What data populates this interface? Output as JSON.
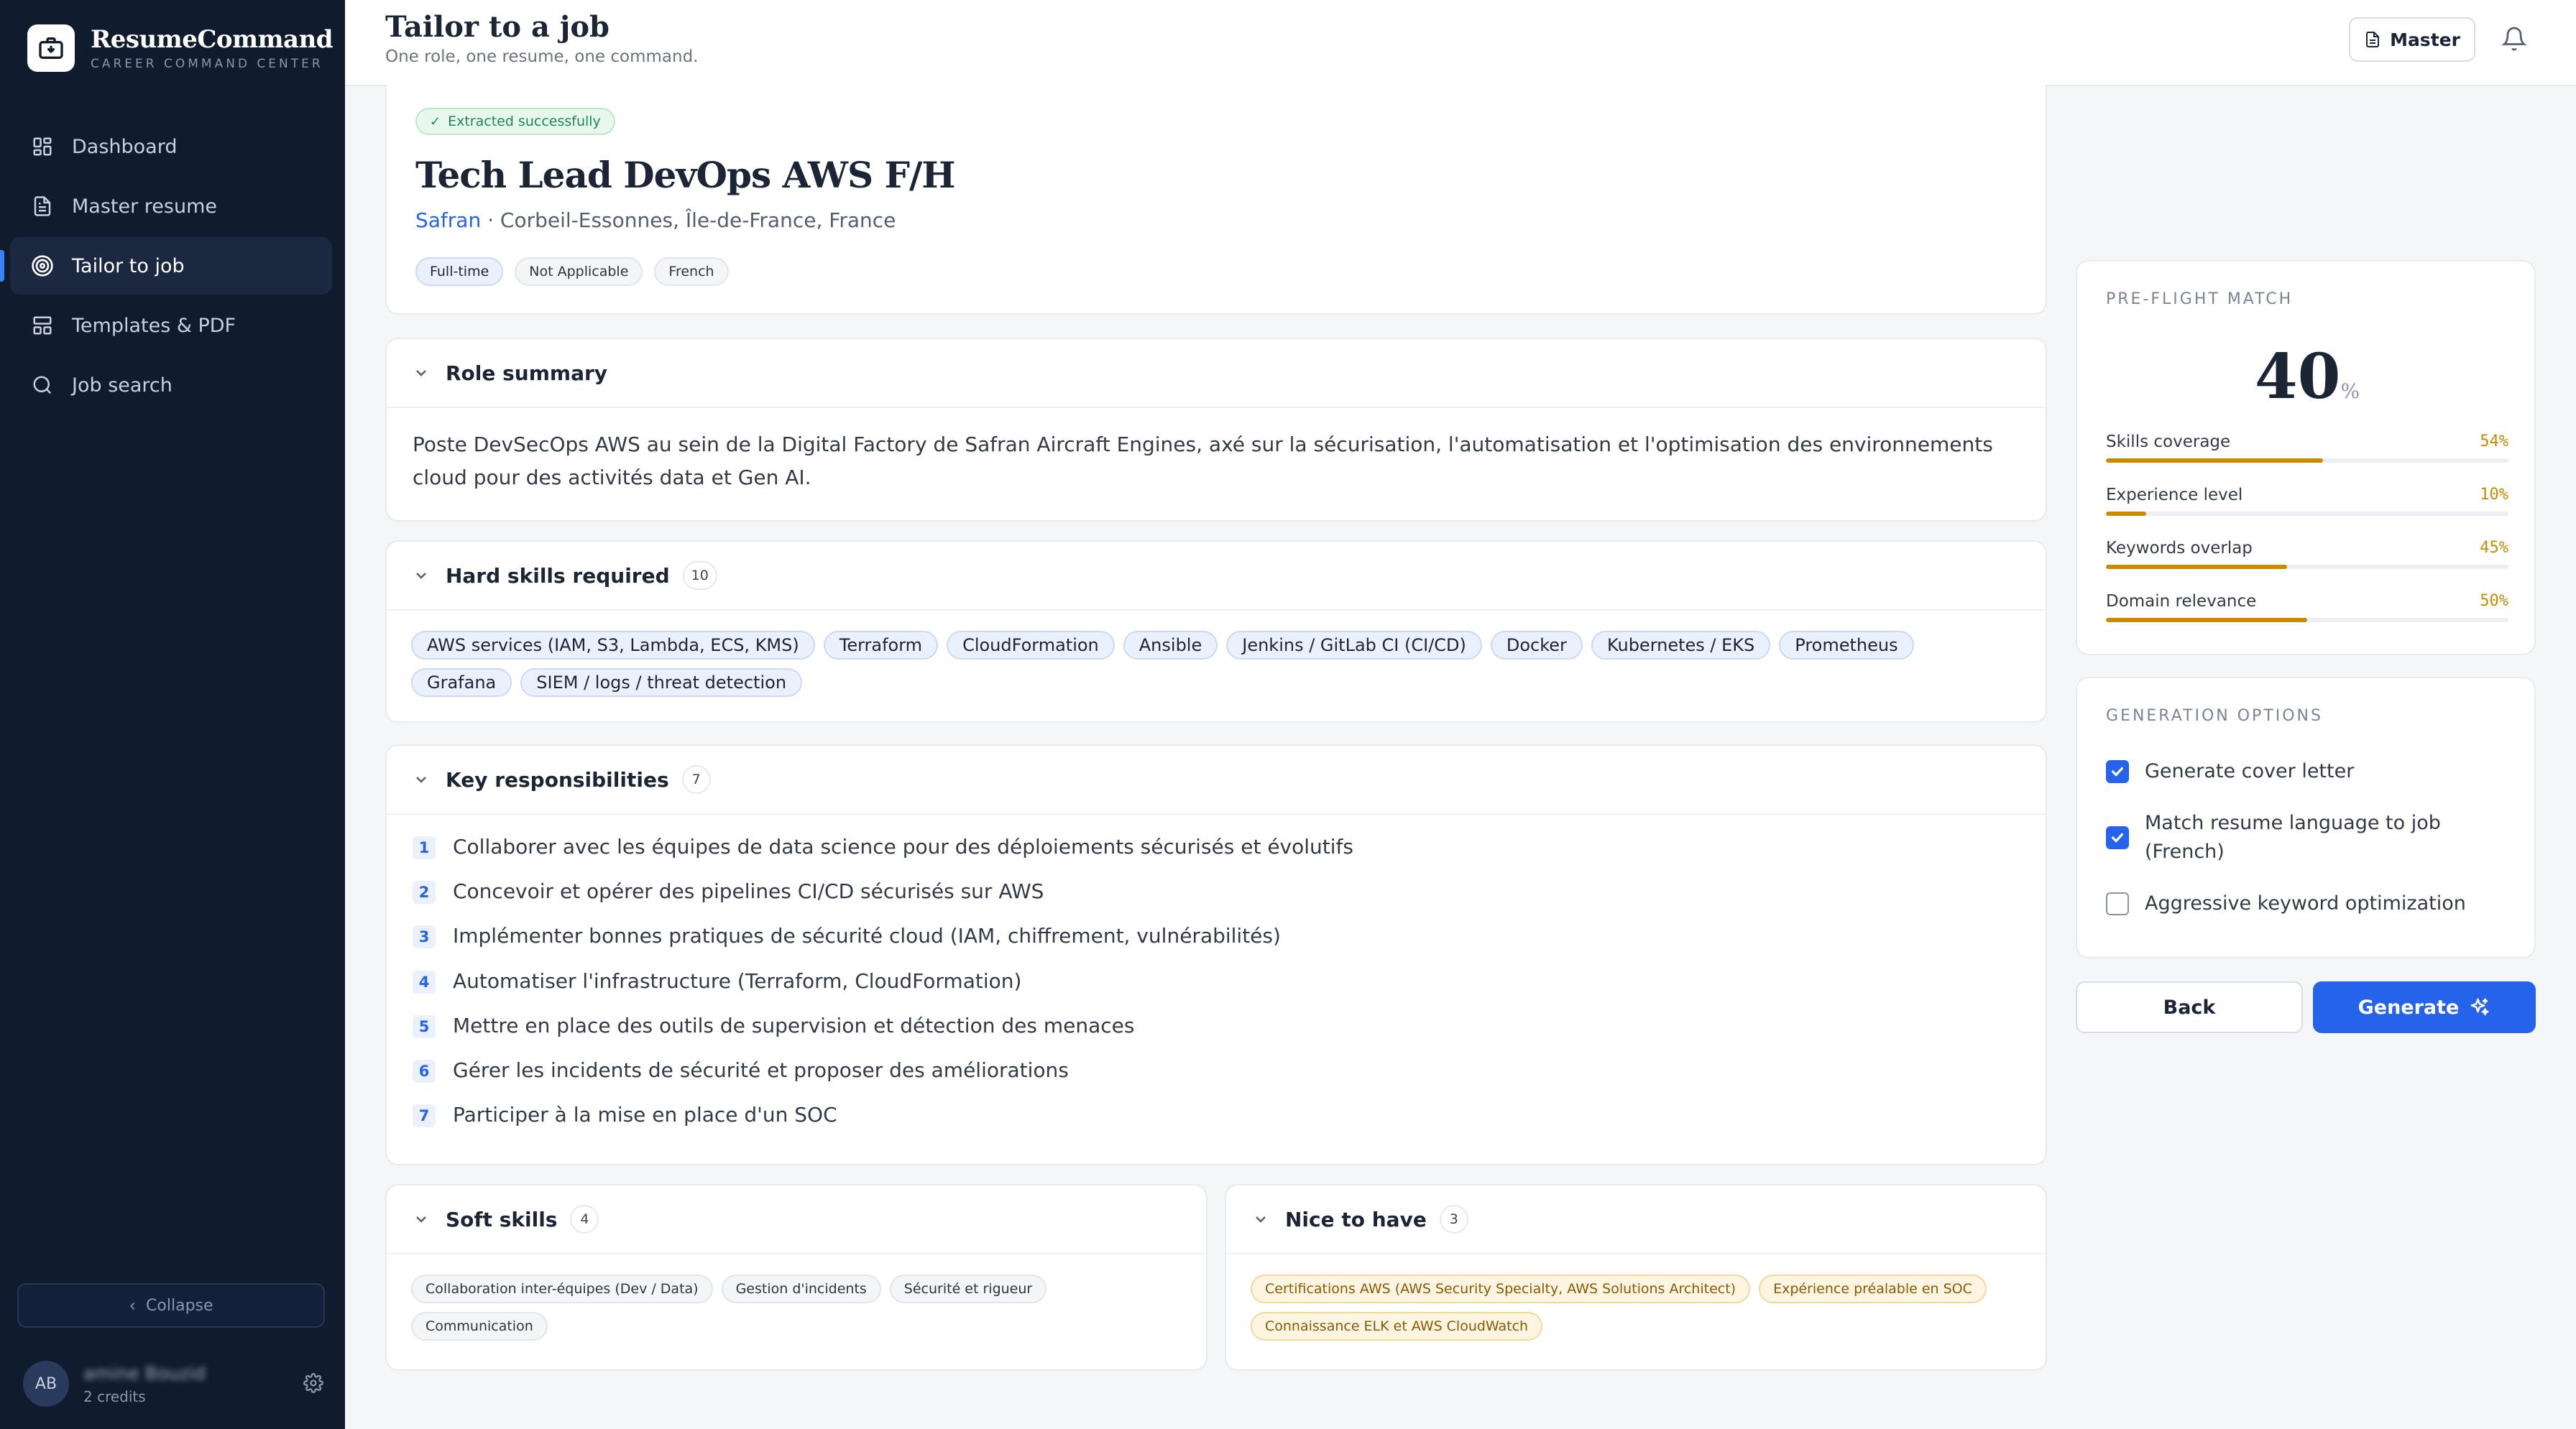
{
  "brand": {
    "name": "ResumeCommand",
    "tagline": "CAREER COMMAND CENTER"
  },
  "sidebar": {
    "items": [
      {
        "label": "Dashboard",
        "icon": "dashboard-icon",
        "active": false
      },
      {
        "label": "Master resume",
        "icon": "document-icon",
        "active": false
      },
      {
        "label": "Tailor to job",
        "icon": "target-icon",
        "active": true
      },
      {
        "label": "Templates & PDF",
        "icon": "layout-icon",
        "active": false
      },
      {
        "label": "Job search",
        "icon": "search-icon",
        "active": false
      }
    ],
    "collapse_label": "Collapse",
    "user": {
      "initials": "AB",
      "name": "amine Bouzid",
      "credits": "2 credits"
    }
  },
  "header": {
    "title": "Tailor to a job",
    "subtitle": "One role, one resume, one command.",
    "master_label": "Master"
  },
  "job": {
    "status": "Extracted successfully",
    "title": "Tech Lead DevOps AWS F/H",
    "company": "Safran",
    "location": " · Corbeil-Essonnes, Île-de-France, France",
    "tags": [
      "Full-time",
      "Not Applicable",
      "French"
    ]
  },
  "role_summary": {
    "title": "Role summary",
    "text": "Poste DevSecOps AWS au sein de la Digital Factory de Safran Aircraft Engines, axé sur la sécurisation, l'automatisation et l'optimisation des environnements cloud pour des activités data et Gen AI."
  },
  "hard_skills": {
    "title": "Hard skills required",
    "count": "10",
    "items": [
      "AWS services (IAM, S3, Lambda, ECS, KMS)",
      "Terraform",
      "CloudFormation",
      "Ansible",
      "Jenkins / GitLab CI (CI/CD)",
      "Docker",
      "Kubernetes / EKS",
      "Prometheus",
      "Grafana",
      "SIEM / logs / threat detection"
    ]
  },
  "responsibilities": {
    "title": "Key responsibilities",
    "count": "7",
    "items": [
      "Collaborer avec les équipes de data science pour des déploiements sécurisés et évolutifs",
      "Concevoir et opérer des pipelines CI/CD sécurisés sur AWS",
      "Implémenter bonnes pratiques de sécurité cloud (IAM, chiffrement, vulnérabilités)",
      "Automatiser l'infrastructure (Terraform, CloudFormation)",
      "Mettre en place des outils de supervision et détection des menaces",
      "Gérer les incidents de sécurité et proposer des améliorations",
      "Participer à la mise en place d'un SOC"
    ]
  },
  "soft_skills": {
    "title": "Soft skills",
    "count": "4",
    "items": [
      "Collaboration inter-équipes (Dev / Data)",
      "Gestion d'incidents",
      "Sécurité et rigueur",
      "Communication"
    ]
  },
  "nice_to_have": {
    "title": "Nice to have",
    "count": "3",
    "items": [
      "Certifications AWS (AWS Security Specialty, AWS Solutions Architect)",
      "Expérience préalable en SOC",
      "Connaissance ELK et AWS CloudWatch"
    ]
  },
  "preflight": {
    "label": "PRE-FLIGHT MATCH",
    "score": "40",
    "score_unit": "%",
    "metrics": [
      {
        "label": "Skills coverage",
        "value": "54%",
        "fraction": 0.54
      },
      {
        "label": "Experience level",
        "value": "10%",
        "fraction": 0.1
      },
      {
        "label": "Keywords overlap",
        "value": "45%",
        "fraction": 0.45
      },
      {
        "label": "Domain relevance",
        "value": "50%",
        "fraction": 0.5
      }
    ]
  },
  "generation": {
    "label": "GENERATION OPTIONS",
    "options": [
      {
        "label": "Generate cover letter",
        "checked": true
      },
      {
        "label": "Match resume language to job (French)",
        "checked": true
      },
      {
        "label": "Aggressive keyword optimization",
        "checked": false
      }
    ]
  },
  "actions": {
    "back": "Back",
    "generate": "Generate"
  },
  "colors": {
    "accent": "#2563eb",
    "sidebar": "#111b2e",
    "metric": "#c98a00"
  }
}
